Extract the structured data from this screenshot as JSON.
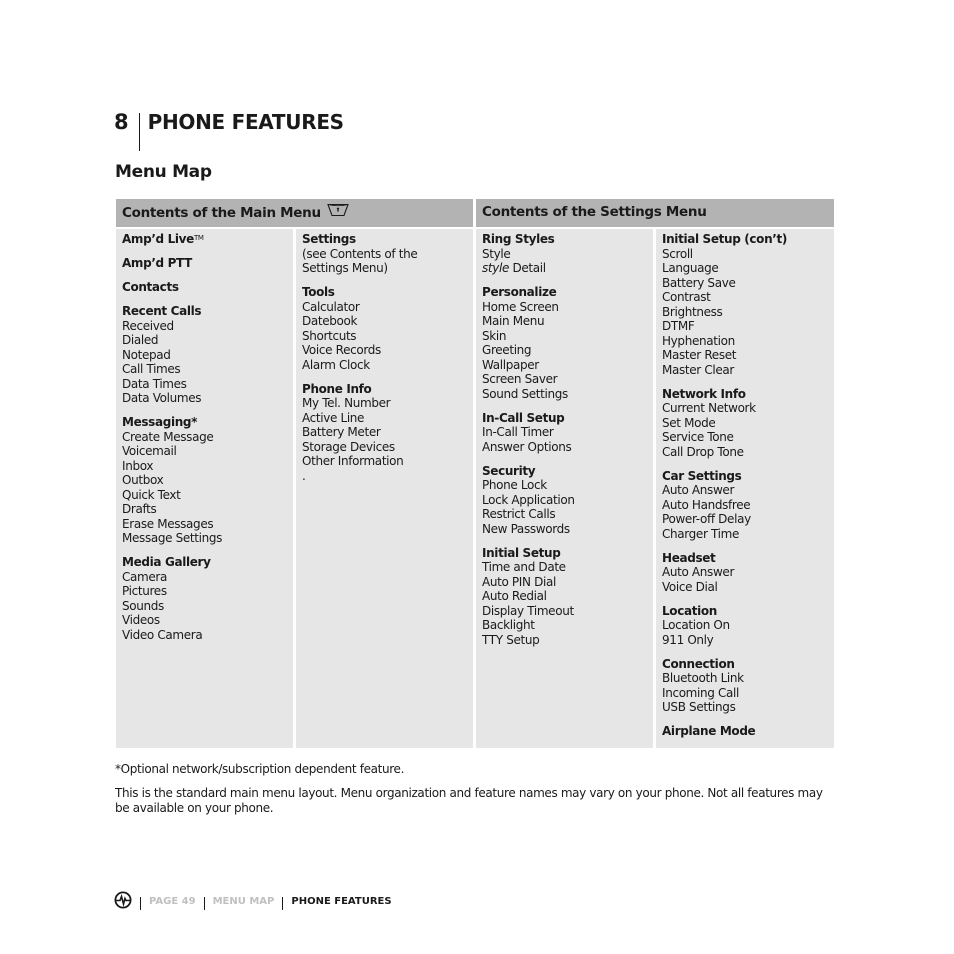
{
  "chapter": {
    "number": "8",
    "title": "PHONE FEATURES"
  },
  "section_title": "Menu Map",
  "table": {
    "headers": {
      "main": "Contents of the Main Menu",
      "main_icon": "menu-key-icon",
      "settings": "Contents of the Settings Menu"
    },
    "columns": [
      {
        "groups": [
          {
            "title": "Amp’d Live",
            "superscript": "TM",
            "items": []
          },
          {
            "title": "Amp’d PTT",
            "items": []
          },
          {
            "title": "Contacts",
            "items": []
          },
          {
            "title": "Recent Calls",
            "items": [
              "Received",
              "Dialed",
              "Notepad",
              "Call Times",
              "Data Times",
              "Data Volumes"
            ]
          },
          {
            "title": "Messaging*",
            "items": [
              "Create Message",
              "Voicemail",
              "Inbox",
              "Outbox",
              "Quick Text",
              "Drafts",
              "Erase Messages",
              "Message Settings"
            ]
          },
          {
            "title": "Media Gallery",
            "items": [
              "Camera",
              "Pictures",
              "Sounds",
              "Videos",
              "Video Camera"
            ]
          }
        ]
      },
      {
        "groups": [
          {
            "title": "Settings",
            "items": [
              "(see Contents of the",
              "Settings Menu)"
            ]
          },
          {
            "title": "Tools",
            "items": [
              "Calculator",
              "Datebook",
              "Shortcuts",
              "Voice Records",
              "Alarm Clock"
            ]
          },
          {
            "title": "Phone Info",
            "items": [
              "My Tel. Number",
              "Active Line",
              "Battery Meter",
              "Storage Devices",
              "Other Information",
              "."
            ]
          }
        ]
      },
      {
        "groups": [
          {
            "title": "Ring Styles",
            "items": [
              "Style",
              "style|Detail"
            ]
          },
          {
            "title": "Personalize",
            "items": [
              "Home Screen",
              "Main Menu",
              "Skin",
              "Greeting",
              "Wallpaper",
              "Screen Saver",
              "Sound Settings"
            ]
          },
          {
            "title": "In-Call Setup",
            "items": [
              "In-Call Timer",
              "Answer Options"
            ]
          },
          {
            "title": "Security",
            "items": [
              "Phone Lock",
              "Lock Application",
              "Restrict Calls",
              "New Passwords"
            ]
          },
          {
            "title": "Initial Setup",
            "items": [
              "Time and Date",
              "Auto PIN Dial",
              "Auto Redial",
              "Display Timeout",
              "Backlight",
              "TTY Setup"
            ]
          }
        ]
      },
      {
        "groups": [
          {
            "title": "Initial Setup (con’t)",
            "items": [
              "Scroll",
              "Language",
              "Battery Save",
              "Contrast",
              "Brightness",
              "DTMF",
              "Hyphenation",
              "Master Reset",
              "Master Clear"
            ]
          },
          {
            "title": "Network Info",
            "items": [
              "Current Network",
              "Set Mode",
              "Service Tone",
              "Call Drop Tone"
            ]
          },
          {
            "title": "Car Settings",
            "items": [
              "Auto Answer",
              "Auto Handsfree",
              "Power-off Delay",
              "Charger Time"
            ]
          },
          {
            "title": "Headset",
            "items": [
              "Auto Answer",
              "Voice Dial"
            ]
          },
          {
            "title": "Location",
            "items": [
              "Location On",
              "911 Only"
            ]
          },
          {
            "title": "Connection",
            "items": [
              "Bluetooth Link",
              "Incoming Call",
              "USB Settings"
            ]
          },
          {
            "title": "Airplane Mode",
            "items": []
          }
        ]
      }
    ]
  },
  "footnote": "*Optional network/subscription dependent feature.",
  "note": "This is the standard main menu layout. Menu organization and feature names may vary on your phone. Not all features may be available on your phone.",
  "footer": {
    "logo_icon": "brand-logo-icon",
    "page": "PAGE 49",
    "section": "MENU MAP",
    "chapter": "PHONE FEATURES"
  }
}
